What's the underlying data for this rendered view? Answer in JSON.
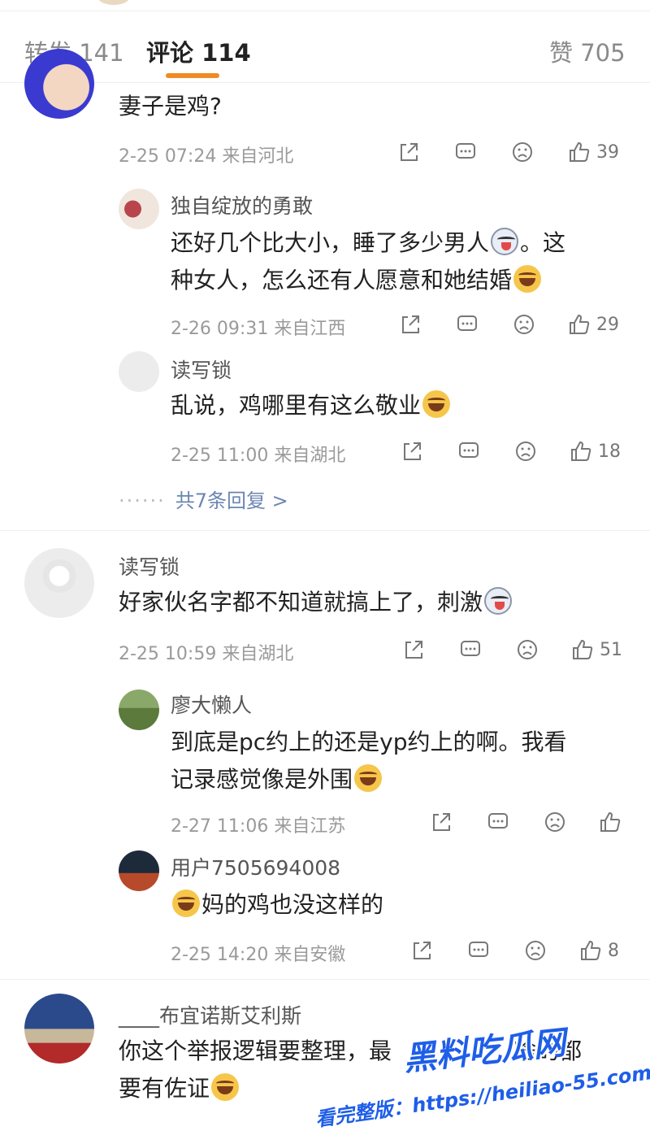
{
  "tabs": [
    {
      "label": "转发 141"
    },
    {
      "label": "评论 114"
    },
    {
      "label": "赞 705"
    }
  ],
  "comments": [
    {
      "text": "妻子是鸡?",
      "time": "2-25 07:24",
      "location": "来自河北",
      "likes": "39",
      "replies": [
        {
          "name": "独自绽放的勇敢",
          "text1": "还好几个比大小，睡了多少男人",
          "text1b": "。这",
          "text2": "种女人，怎么还有人愿意和她结婚",
          "time": "2-26 09:31",
          "location": "来自江西",
          "likes": "29"
        },
        {
          "name": "读写锁",
          "text1": "乱说，鸡哪里有这么敬业",
          "time": "2-25 11:00",
          "location": "来自湖北",
          "likes": "18"
        }
      ],
      "more_replies": "共7条回复 >"
    },
    {
      "name": "读写锁",
      "text": "好家伙名字都不知道就搞上了，刺激",
      "time": "2-25 10:59",
      "location": "来自湖北",
      "likes": "51",
      "replies": [
        {
          "name": "廖大懒人",
          "text1": "到底是pc约上的还是yp约上的啊。我看",
          "text2": "记录感觉像是外围",
          "time": "2-27 11:06",
          "location": "来自江苏"
        },
        {
          "name": "用户7505694008",
          "text1": "妈的鸡也没这样的",
          "time": "2-25 14:20",
          "location": "来自安徽",
          "likes": "8"
        }
      ]
    },
    {
      "name": "____布宜诺斯艾利斯",
      "text1": "你这个举报逻辑要整理，最",
      "text1b": "啥的都",
      "text2": "要有佐证"
    }
  ],
  "watermark": {
    "brand": "黑料吃瓜网",
    "url": "看完整版：https://heiliao-55.com"
  },
  "colors": {
    "accent": "#f08a24",
    "link": "#6b86b3",
    "watermark": "#1e5ee8"
  }
}
